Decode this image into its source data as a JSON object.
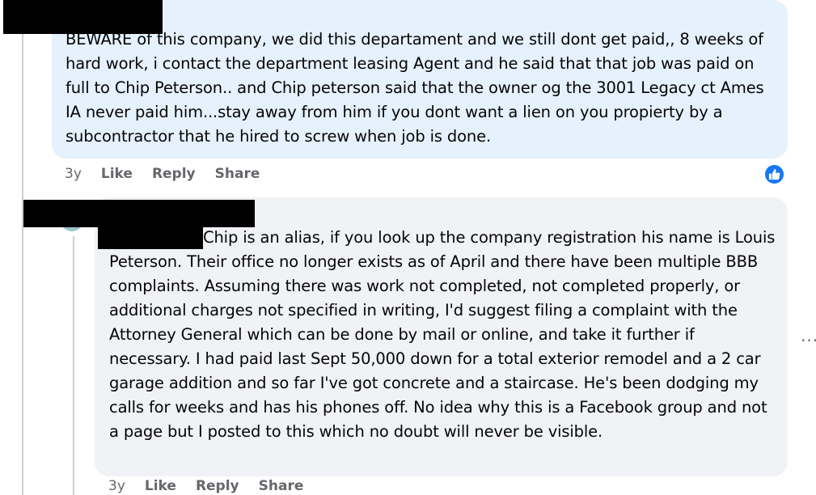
{
  "comment_1": {
    "text": "BEWARE of this company, we did this departament and we still dont get paid,, 8 weeks of hard work, i contact the department leasing Agent and he said that that job was paid on full to Chip Peterson.. and Chip peterson said that the owner og the 3001 Legacy ct Ames IA never paid him...stay away from him if you dont want a lien on you propierty by a subcontractor that he hired to screw when job is done.",
    "time": "3y",
    "like_label": "Like",
    "reply_label": "Reply",
    "share_label": "Share",
    "reaction_icon": "like-icon",
    "accent_color": "#1877f2"
  },
  "comment_2": {
    "text": "Chip is an alias, if you look up the company registration his name is Louis Peterson. Their office no longer exists as of April and there have been multiple BBB complaints. Assuming there was work not completed, not completed properly, or additional charges not specified in writing, I'd suggest filing a complaint with the Attorney General which can be done by mail or online, and take it further if necessary. I had paid last Sept 50,000 down for a total exterior remodel and a 2 car garage addition and so far I've got concrete and a staircase. He's been dodging my calls for weeks and has his phones off. No idea why this is a Facebook group and not a page but I posted to this which no doubt will never be visible.",
    "time": "3y",
    "like_label": "Like",
    "reply_label": "Reply",
    "share_label": "Share"
  },
  "more_label": "..."
}
